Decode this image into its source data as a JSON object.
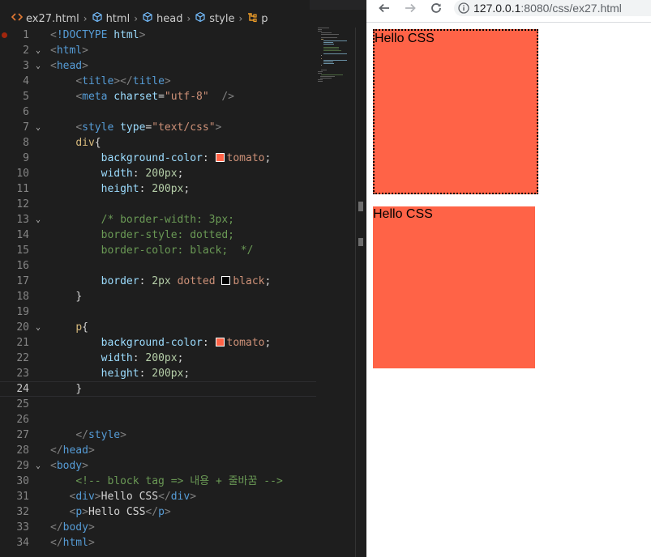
{
  "editor": {
    "breadcrumb": [
      {
        "label": "ex27.html",
        "icon": "html-file-icon"
      },
      {
        "label": "html",
        "icon": "element-icon"
      },
      {
        "label": "head",
        "icon": "element-icon"
      },
      {
        "label": "style",
        "icon": "element-icon"
      },
      {
        "label": "p",
        "icon": "css-rule-icon"
      }
    ],
    "lines": [
      {
        "n": "1",
        "tokens": [
          [
            "t-br",
            "<"
          ],
          [
            "t-doc",
            "!DOCTYPE"
          ],
          [
            "t-txt",
            " "
          ],
          [
            "t-attr",
            "html"
          ],
          [
            "t-br",
            ">"
          ]
        ]
      },
      {
        "n": "2",
        "tokens": [
          [
            "t-br",
            "<"
          ],
          [
            "t-tag",
            "html"
          ],
          [
            "t-br",
            ">"
          ]
        ]
      },
      {
        "n": "3",
        "tokens": [
          [
            "t-br",
            "<"
          ],
          [
            "t-tag",
            "head"
          ],
          [
            "t-br",
            ">"
          ]
        ]
      },
      {
        "n": "4",
        "tokens": [
          [
            "t-txt",
            "    "
          ],
          [
            "t-br",
            "<"
          ],
          [
            "t-tag",
            "title"
          ],
          [
            "t-br",
            "></"
          ],
          [
            "t-tag",
            "title"
          ],
          [
            "t-br",
            ">"
          ]
        ]
      },
      {
        "n": "5",
        "tokens": [
          [
            "t-txt",
            "    "
          ],
          [
            "t-br",
            "<"
          ],
          [
            "t-tag",
            "meta"
          ],
          [
            "t-txt",
            " "
          ],
          [
            "t-attr",
            "charset"
          ],
          [
            "t-txt",
            "="
          ],
          [
            "t-str",
            "\"utf-8\""
          ],
          [
            "t-txt",
            "  "
          ],
          [
            "t-br",
            "/>"
          ]
        ]
      },
      {
        "n": "6",
        "tokens": []
      },
      {
        "n": "7",
        "tokens": [
          [
            "t-txt",
            "    "
          ],
          [
            "t-br",
            "<"
          ],
          [
            "t-tag",
            "style"
          ],
          [
            "t-txt",
            " "
          ],
          [
            "t-attr",
            "type"
          ],
          [
            "t-txt",
            "="
          ],
          [
            "t-str",
            "\"text/css\""
          ],
          [
            "t-br",
            ">"
          ]
        ]
      },
      {
        "n": "8",
        "tokens": [
          [
            "t-txt",
            "    "
          ],
          [
            "t-sel",
            "div"
          ],
          [
            "t-punc",
            "{"
          ]
        ]
      },
      {
        "n": "9",
        "tokens": [
          [
            "t-txt",
            "        "
          ],
          [
            "t-prop",
            "background-color"
          ],
          [
            "t-punc",
            ": "
          ],
          [
            "swatch",
            "#ff6347"
          ],
          [
            "t-str",
            "tomato"
          ],
          [
            "t-punc",
            ";"
          ]
        ]
      },
      {
        "n": "10",
        "tokens": [
          [
            "t-txt",
            "        "
          ],
          [
            "t-prop",
            "width"
          ],
          [
            "t-punc",
            ": "
          ],
          [
            "t-num",
            "200px"
          ],
          [
            "t-punc",
            ";"
          ]
        ]
      },
      {
        "n": "11",
        "tokens": [
          [
            "t-txt",
            "        "
          ],
          [
            "t-prop",
            "height"
          ],
          [
            "t-punc",
            ": "
          ],
          [
            "t-num",
            "200px"
          ],
          [
            "t-punc",
            ";"
          ]
        ]
      },
      {
        "n": "12",
        "tokens": []
      },
      {
        "n": "13",
        "tokens": [
          [
            "t-txt",
            "        "
          ],
          [
            "t-cmt",
            "/* border-width: 3px;"
          ]
        ]
      },
      {
        "n": "14",
        "tokens": [
          [
            "t-txt",
            "        "
          ],
          [
            "t-cmt",
            "border-style: dotted;"
          ]
        ]
      },
      {
        "n": "15",
        "tokens": [
          [
            "t-txt",
            "        "
          ],
          [
            "t-cmt",
            "border-color: black;  */"
          ]
        ]
      },
      {
        "n": "16",
        "tokens": []
      },
      {
        "n": "17",
        "tokens": [
          [
            "t-txt",
            "        "
          ],
          [
            "t-prop",
            "border"
          ],
          [
            "t-punc",
            ": "
          ],
          [
            "t-num",
            "2px"
          ],
          [
            "t-txt",
            " "
          ],
          [
            "t-str",
            "dotted"
          ],
          [
            "t-txt",
            " "
          ],
          [
            "swatch",
            "#000000"
          ],
          [
            "t-str",
            "black"
          ],
          [
            "t-punc",
            ";"
          ]
        ]
      },
      {
        "n": "18",
        "tokens": [
          [
            "t-txt",
            "    "
          ],
          [
            "t-punc",
            "}"
          ]
        ]
      },
      {
        "n": "19",
        "tokens": []
      },
      {
        "n": "20",
        "tokens": [
          [
            "t-txt",
            "    "
          ],
          [
            "t-sel",
            "p"
          ],
          [
            "t-punc",
            "{"
          ]
        ]
      },
      {
        "n": "21",
        "tokens": [
          [
            "t-txt",
            "        "
          ],
          [
            "t-prop",
            "background-color"
          ],
          [
            "t-punc",
            ": "
          ],
          [
            "swatch",
            "#ff6347"
          ],
          [
            "t-str",
            "tomato"
          ],
          [
            "t-punc",
            ";"
          ]
        ]
      },
      {
        "n": "22",
        "tokens": [
          [
            "t-txt",
            "        "
          ],
          [
            "t-prop",
            "width"
          ],
          [
            "t-punc",
            ": "
          ],
          [
            "t-num",
            "200px"
          ],
          [
            "t-punc",
            ";"
          ]
        ]
      },
      {
        "n": "23",
        "tokens": [
          [
            "t-txt",
            "        "
          ],
          [
            "t-prop",
            "height"
          ],
          [
            "t-punc",
            ": "
          ],
          [
            "t-num",
            "200px"
          ],
          [
            "t-punc",
            ";"
          ]
        ]
      },
      {
        "n": "24",
        "tokens": [
          [
            "t-txt",
            "    "
          ],
          [
            "t-punc",
            "}"
          ]
        ]
      },
      {
        "n": "25",
        "tokens": []
      },
      {
        "n": "26",
        "tokens": []
      },
      {
        "n": "27",
        "tokens": [
          [
            "t-txt",
            "    "
          ],
          [
            "t-br",
            "</"
          ],
          [
            "t-tag",
            "style"
          ],
          [
            "t-br",
            ">"
          ]
        ]
      },
      {
        "n": "28",
        "tokens": [
          [
            "t-br",
            "</"
          ],
          [
            "t-tag",
            "head"
          ],
          [
            "t-br",
            ">"
          ]
        ]
      },
      {
        "n": "29",
        "tokens": [
          [
            "t-br",
            "<"
          ],
          [
            "t-tag",
            "body"
          ],
          [
            "t-br",
            ">"
          ]
        ]
      },
      {
        "n": "30",
        "tokens": [
          [
            "t-txt",
            "    "
          ],
          [
            "t-cmt",
            "<!-- block tag => 내용 + 줄바꿈 -->"
          ]
        ]
      },
      {
        "n": "31",
        "tokens": [
          [
            "t-txt",
            "   "
          ],
          [
            "t-br",
            "<"
          ],
          [
            "t-tag",
            "div"
          ],
          [
            "t-br",
            ">"
          ],
          [
            "t-txt",
            "Hello CSS"
          ],
          [
            "t-br",
            "</"
          ],
          [
            "t-tag",
            "div"
          ],
          [
            "t-br",
            ">"
          ]
        ]
      },
      {
        "n": "32",
        "tokens": [
          [
            "t-txt",
            "   "
          ],
          [
            "t-br",
            "<"
          ],
          [
            "t-tag",
            "p"
          ],
          [
            "t-br",
            ">"
          ],
          [
            "t-txt",
            "Hello CSS"
          ],
          [
            "t-br",
            "</"
          ],
          [
            "t-tag",
            "p"
          ],
          [
            "t-br",
            ">"
          ]
        ]
      },
      {
        "n": "33",
        "tokens": [
          [
            "t-br",
            "</"
          ],
          [
            "t-tag",
            "body"
          ],
          [
            "t-br",
            ">"
          ]
        ]
      },
      {
        "n": "34",
        "tokens": [
          [
            "t-br",
            "</"
          ],
          [
            "t-tag",
            "html"
          ],
          [
            "t-br",
            ">"
          ]
        ]
      }
    ],
    "fold_lines": [
      "2",
      "3",
      "7",
      "13",
      "20",
      "29"
    ],
    "current_line": "24",
    "breakpoint_line": "1"
  },
  "browser": {
    "nav": {
      "back_icon": "back-arrow-icon",
      "forward_icon": "forward-arrow-icon",
      "reload_icon": "reload-icon",
      "info_icon": "info-icon"
    },
    "url_host": "127.0.0.1",
    "url_rest": ":8080/css/ex27.html",
    "page": {
      "div_text": "Hello CSS",
      "p_text": "Hello CSS"
    },
    "colors": {
      "tomato": "#ff6347",
      "border": "#000000"
    }
  }
}
